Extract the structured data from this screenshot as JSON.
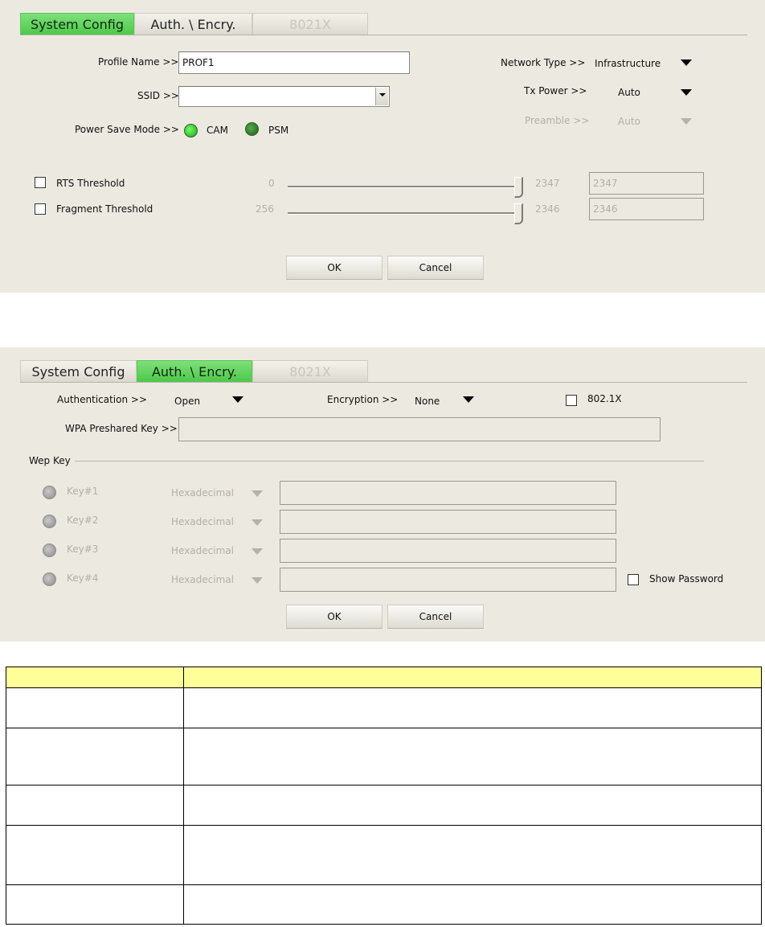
{
  "panel1": {
    "tabs": [
      {
        "label": "System Config",
        "state": "active"
      },
      {
        "label": "Auth. \\ Encry.",
        "state": "normal"
      },
      {
        "label": "8021X",
        "state": "disabled"
      }
    ],
    "profile_name": {
      "label": "Profile Name >>",
      "value": "PROF1"
    },
    "ssid": {
      "label": "SSID >>",
      "value": ""
    },
    "power_save": {
      "label": "Power Save Mode >>",
      "option_cam": "CAM",
      "option_psm": "PSM"
    },
    "network_type": {
      "label": "Network Type >>",
      "value": "Infrastructure"
    },
    "tx_power": {
      "label": "Tx Power >>",
      "value": "Auto"
    },
    "preamble": {
      "label": "Preamble >>",
      "value": "Auto"
    },
    "rts": {
      "label": "RTS Threshold",
      "min": "0",
      "max": "2347",
      "value": "2347",
      "level": 1.0
    },
    "fragment": {
      "label": "Fragment Threshold",
      "min": "256",
      "max": "2346",
      "value": "2346",
      "level": 1.0
    },
    "ok_label": "OK",
    "cancel_label": "Cancel"
  },
  "panel2": {
    "tabs": [
      {
        "label": "System Config",
        "state": "normal"
      },
      {
        "label": "Auth. \\ Encry.",
        "state": "active"
      },
      {
        "label": "8021X",
        "state": "disabled"
      }
    ],
    "authentication": {
      "label": "Authentication >>",
      "value": "Open"
    },
    "encryption": {
      "label": "Encryption >>",
      "value": "None"
    },
    "dot1x_label": "802.1X",
    "wpa": {
      "label": "WPA Preshared Key >>",
      "value": ""
    },
    "wep_key_label": "Wep Key",
    "keys": [
      {
        "label": "Key#1",
        "format": "Hexadecimal",
        "value": ""
      },
      {
        "label": "Key#2",
        "format": "Hexadecimal",
        "value": ""
      },
      {
        "label": "Key#3",
        "format": "Hexadecimal",
        "value": ""
      },
      {
        "label": "Key#4",
        "format": "Hexadecimal",
        "value": ""
      }
    ],
    "show_password_label": "Show Password",
    "ok_label": "OK",
    "cancel_label": "Cancel"
  },
  "table": {
    "header": [
      "",
      ""
    ],
    "rows": [
      [
        "",
        ""
      ],
      [
        "",
        ""
      ],
      [
        "",
        ""
      ],
      [
        "",
        ""
      ],
      [
        "",
        ""
      ]
    ]
  },
  "colors": {
    "active_tab": "#4ec84a",
    "panel_bg": "#ece9e1",
    "table_header": "#ffff99"
  }
}
